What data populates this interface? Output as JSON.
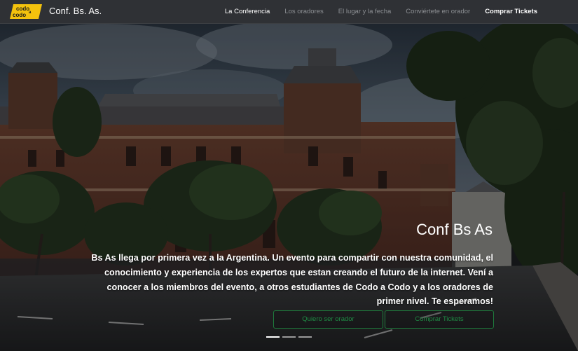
{
  "brand": {
    "logo_line1": "codo",
    "logo_line2": "a",
    "logo_line3": "codo",
    "name": "Conf. Bs. As."
  },
  "nav": {
    "items": [
      {
        "label": "La Conferencia",
        "state": "active"
      },
      {
        "label": "Los oradores",
        "state": "muted"
      },
      {
        "label": "El lugar y la fecha",
        "state": "muted"
      },
      {
        "label": "Conviértete en orador",
        "state": "muted"
      },
      {
        "label": "Comprar Tickets",
        "state": "cta"
      }
    ]
  },
  "hero": {
    "title": "Conf Bs As",
    "text": "Bs As llega por primera vez a la Argentina. Un evento para compartir con nuestra comunidad, el conocimiento y experiencia de los expertos que estan creando el futuro de la internet. Vení a conocer a los miembros del evento, a otros estudiantes de Codo a Codo y a los oradores de primer nivel. Te esperamos!",
    "buttons": {
      "orador": "Quiero ser orador",
      "tickets": "Comprar Tickets"
    },
    "carousel": {
      "slides": 3,
      "active_index": 0
    }
  },
  "colors": {
    "navbar_bg": "#2f3135",
    "logo_yellow": "#f4c20d",
    "button_green": "#1e7a3c"
  }
}
